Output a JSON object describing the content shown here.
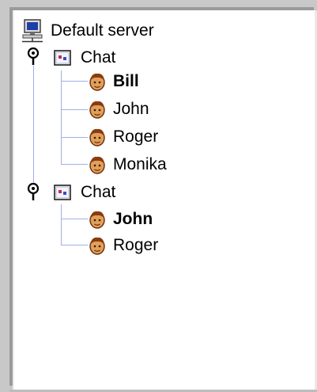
{
  "tree": {
    "root": {
      "label": "Default server",
      "icon": "computer-icon"
    },
    "channels": [
      {
        "label": "Chat",
        "icon": "chat-window-icon",
        "expander": "expanded-handle-icon",
        "users": [
          {
            "name": "Bill",
            "bold": true,
            "icon": "user-face-icon"
          },
          {
            "name": "John",
            "bold": false,
            "icon": "user-face-icon"
          },
          {
            "name": "Roger",
            "bold": false,
            "icon": "user-face-icon"
          },
          {
            "name": "Monika",
            "bold": false,
            "icon": "user-face-icon"
          }
        ]
      },
      {
        "label": "Chat",
        "icon": "chat-window-icon",
        "expander": "expanded-handle-icon",
        "users": [
          {
            "name": "John",
            "bold": true,
            "icon": "user-face-icon"
          },
          {
            "name": "Roger",
            "bold": false,
            "icon": "user-face-icon"
          }
        ]
      }
    ]
  },
  "colors": {
    "tree_line": "#9fb0e8",
    "face": "#e0a05a",
    "hair": "#8a3b10",
    "chat_red": "#c0303a",
    "chat_blue": "#3050c0"
  }
}
